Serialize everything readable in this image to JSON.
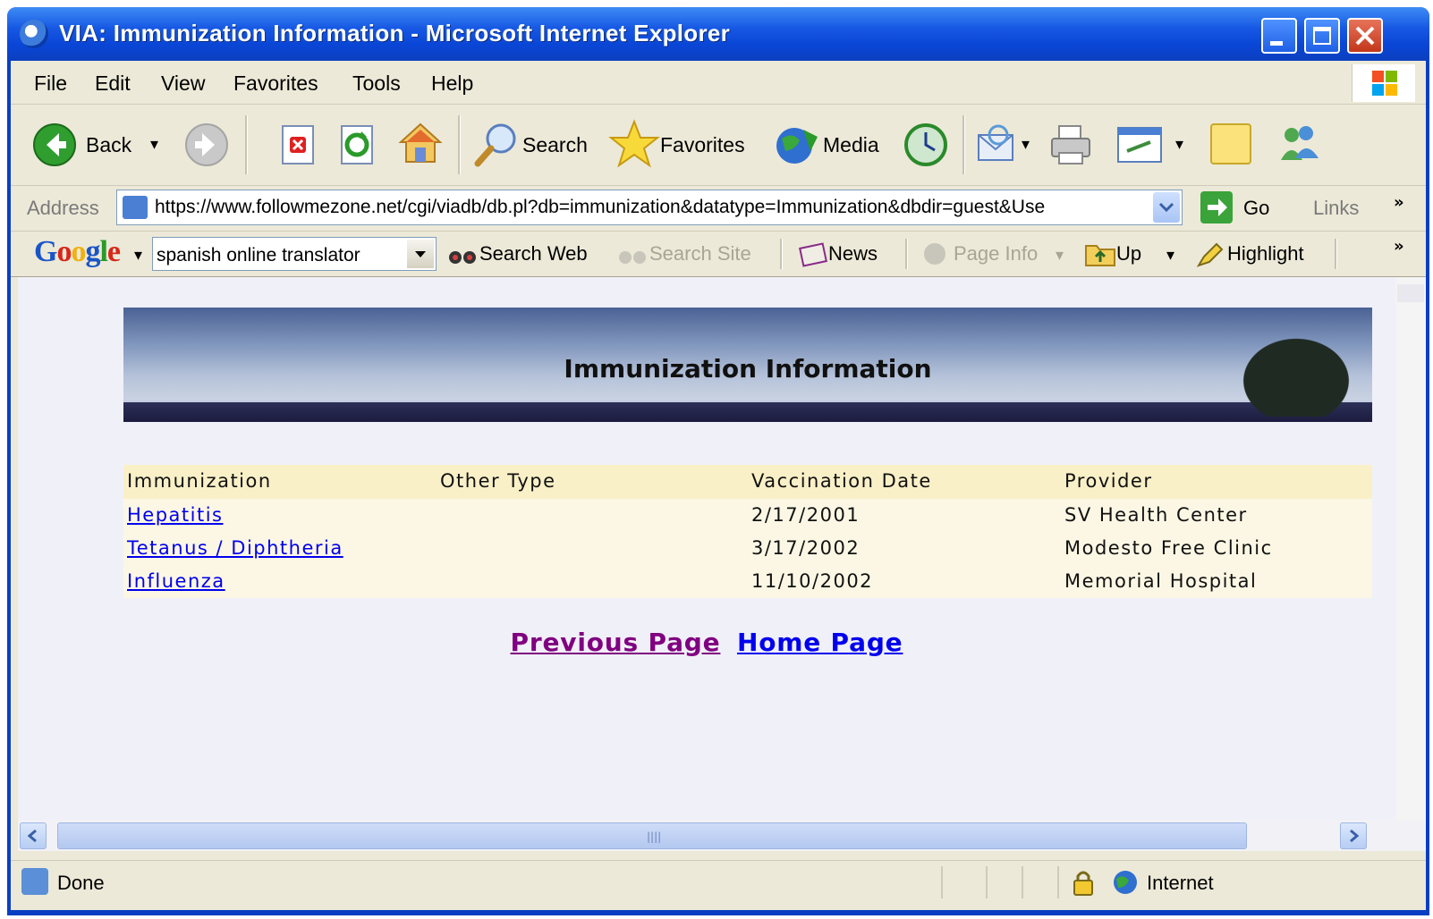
{
  "window": {
    "title": "VIA: Immunization Information - Microsoft Internet Explorer"
  },
  "menu": [
    "File",
    "Edit",
    "View",
    "Favorites",
    "Tools",
    "Help"
  ],
  "toolbar": {
    "back": "Back",
    "search": "Search",
    "favorites": "Favorites",
    "media": "Media"
  },
  "address": {
    "label": "Address",
    "url": "https://www.followmezone.net/cgi/viadb/db.pl?db=immunization&datatype=Immunization&dbdir=guest&Use",
    "go": "Go",
    "links": "Links"
  },
  "google": {
    "logo": "Google",
    "query": "spanish online translator",
    "search_web": "Search Web",
    "search_site": "Search Site",
    "news": "News",
    "page_info": "Page Info",
    "up": "Up",
    "highlight": "Highlight"
  },
  "page": {
    "banner_title": "Immunization Information",
    "columns": [
      "Immunization",
      "Other Type",
      "Vaccination Date",
      "Provider"
    ],
    "rows": [
      {
        "immunization": "Hepatitis",
        "other_type": "",
        "date": "2/17/2001",
        "provider": "SV Health Center"
      },
      {
        "immunization": "Tetanus / Diphtheria",
        "other_type": "",
        "date": "3/17/2002",
        "provider": "Modesto Free Clinic"
      },
      {
        "immunization": "Influenza",
        "other_type": "",
        "date": "11/10/2002",
        "provider": "Memorial Hospital"
      }
    ],
    "prev_link": "Previous Page",
    "home_link": "Home Page"
  },
  "status": {
    "text": "Done",
    "zone": "Internet"
  },
  "colors": {
    "titlebar": "#0a46d6",
    "chrome": "#ece9d8",
    "link": "#0000ee",
    "visited_link": "#800080",
    "table_header": "#faf0c8"
  }
}
